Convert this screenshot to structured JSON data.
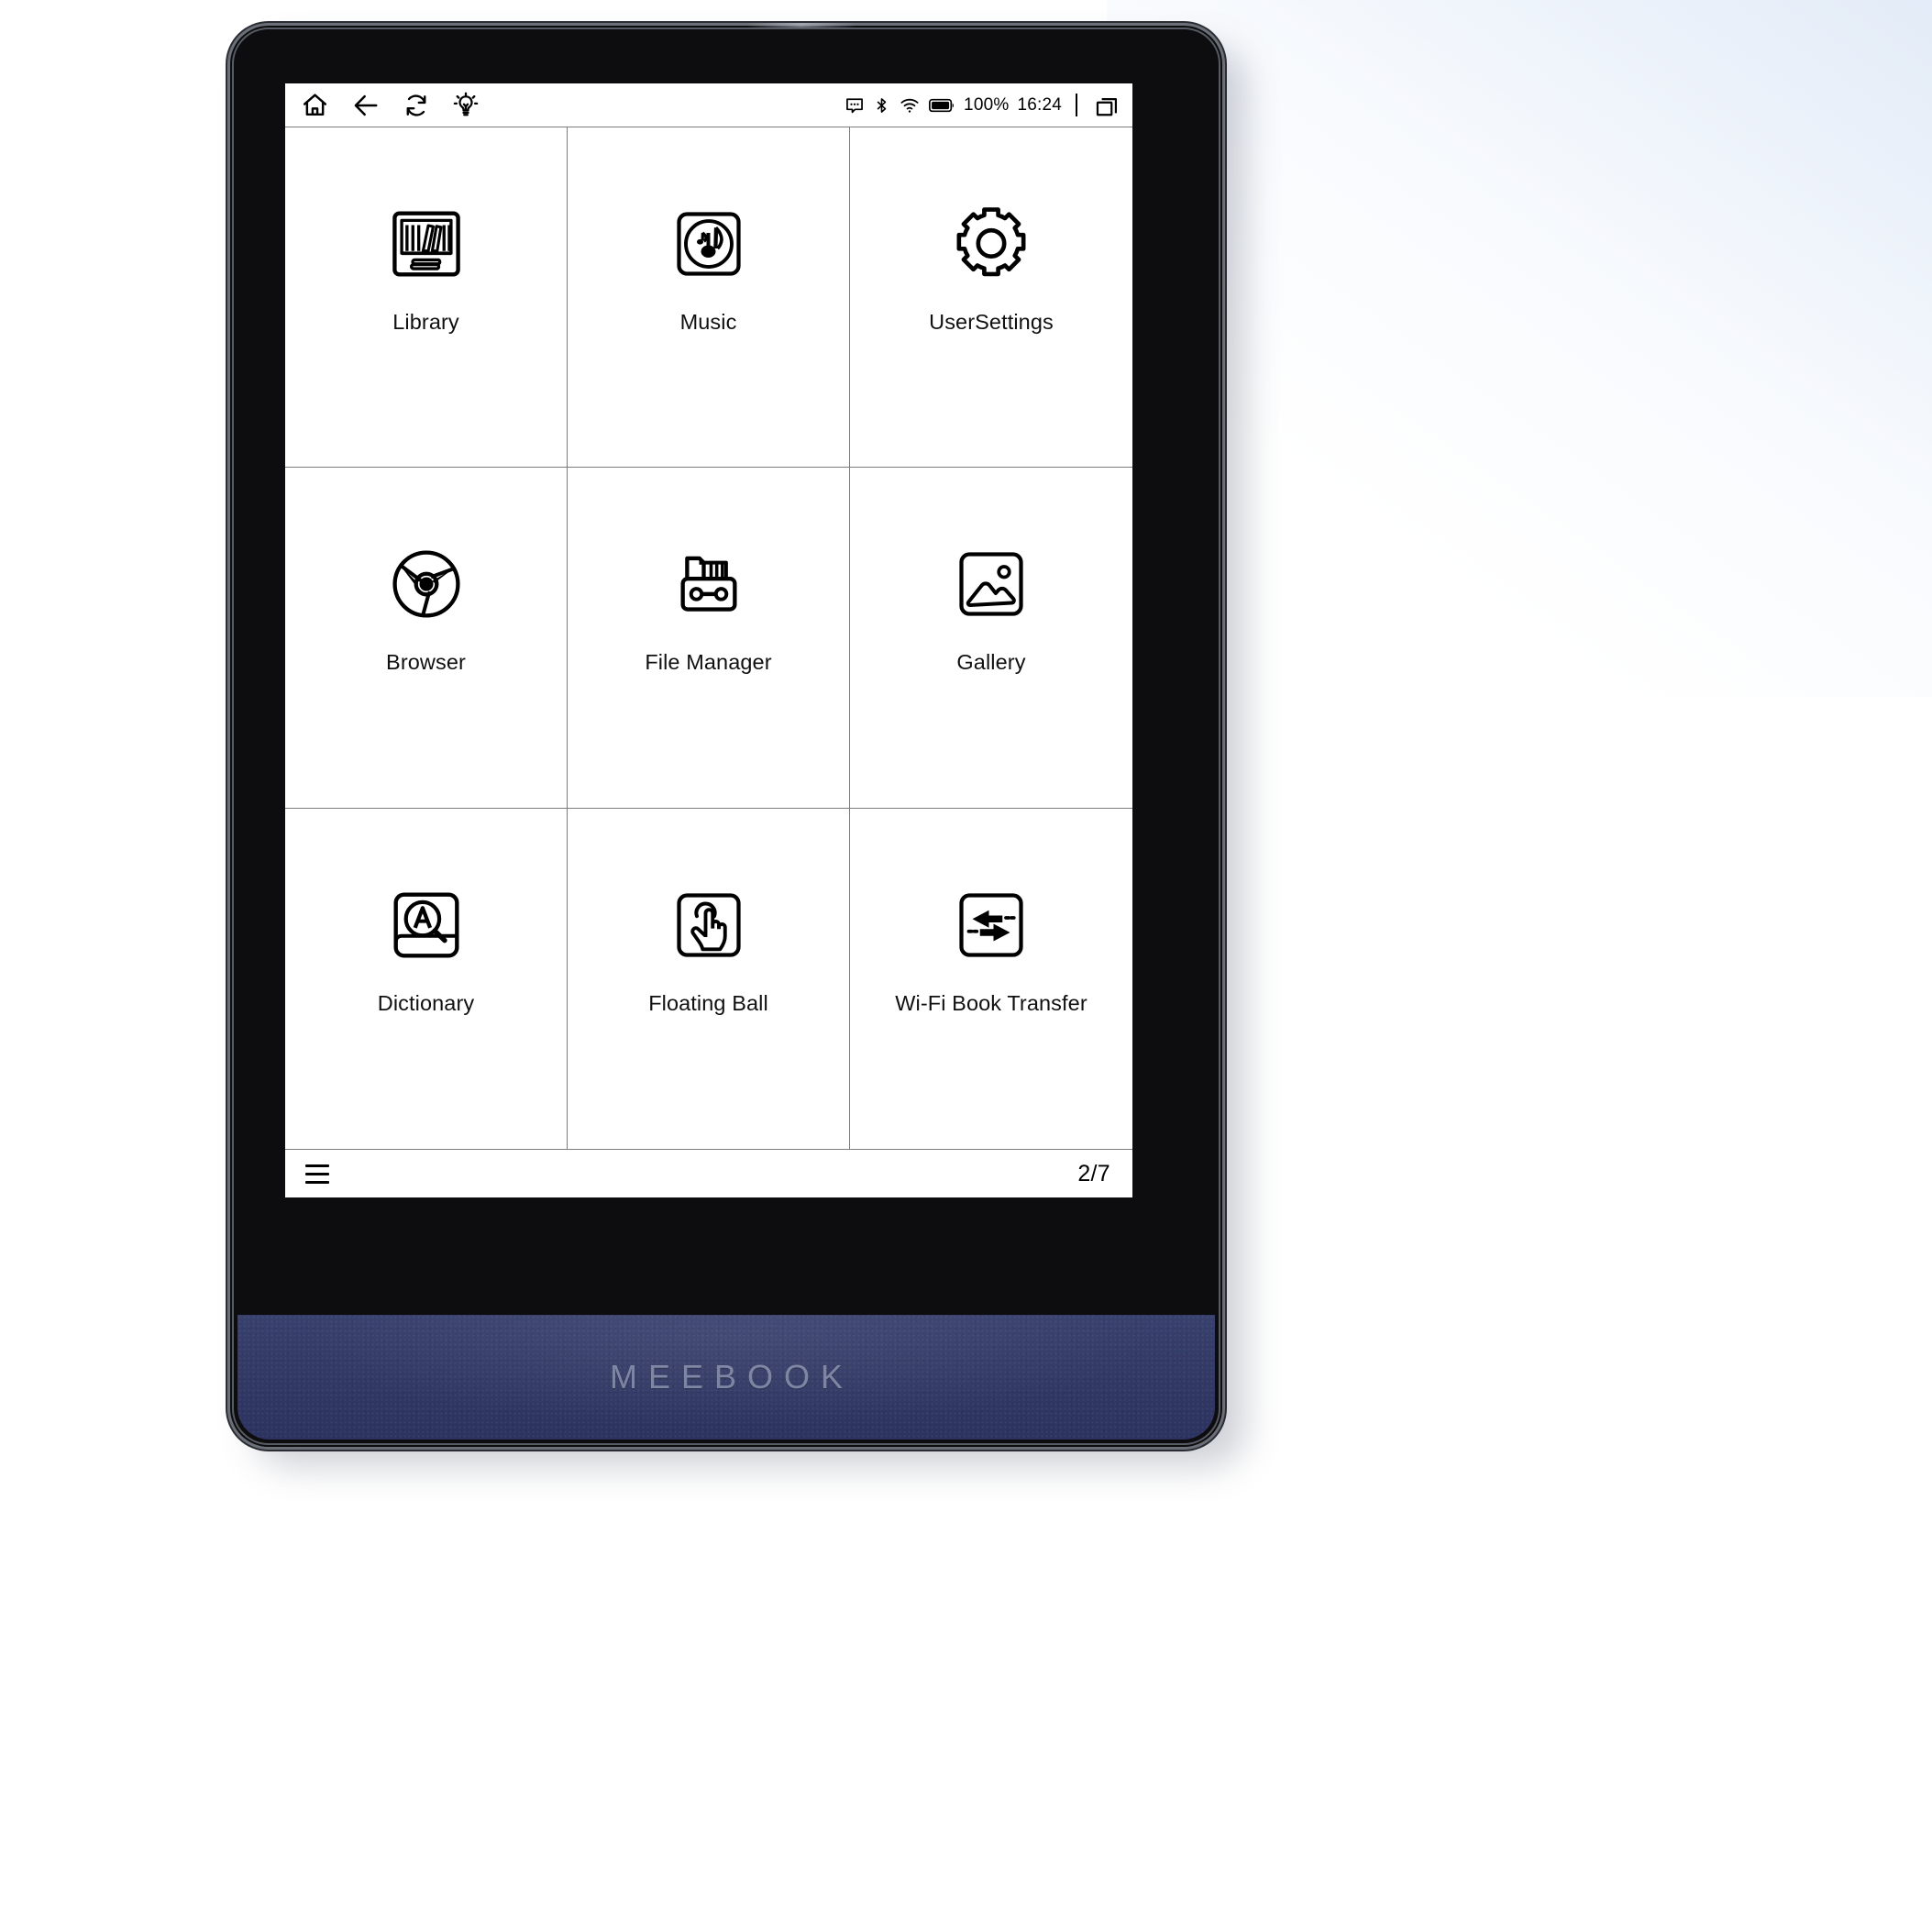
{
  "device": {
    "brand": "MEEBOOK",
    "frame_color": "#0d0d10",
    "chin_color": "#333a66",
    "bezel_rim_color": "#6b6f77"
  },
  "statusbar": {
    "left_icons": [
      {
        "name": "home-icon",
        "label": "Home"
      },
      {
        "name": "back-arrow-icon",
        "label": "Back"
      },
      {
        "name": "refresh-icon",
        "label": "Refresh"
      },
      {
        "name": "lightbulb-icon",
        "label": "Front light"
      }
    ],
    "right_icons": [
      {
        "name": "message-bubble-icon",
        "label": "Notifications"
      },
      {
        "name": "bluetooth-icon",
        "label": "Bluetooth"
      },
      {
        "name": "wifi-icon",
        "label": "Wi-Fi"
      },
      {
        "name": "battery-icon",
        "label": "Battery"
      }
    ],
    "battery_percent": "100%",
    "clock": "16:24",
    "multiwindow_icon": "multi-window-icon"
  },
  "grid": {
    "apps": [
      {
        "label": "Library",
        "icon": "bookshelf-icon"
      },
      {
        "label": "Music",
        "icon": "music-note-icon"
      },
      {
        "label": "UserSettings",
        "icon": "gear-icon"
      },
      {
        "label": "Browser",
        "icon": "chrome-browser-icon"
      },
      {
        "label": "File Manager",
        "icon": "file-drawer-icon"
      },
      {
        "label": "Gallery",
        "icon": "image-mountain-icon"
      },
      {
        "label": "Dictionary",
        "icon": "magnifier-a-book-icon"
      },
      {
        "label": "Floating Ball",
        "icon": "hand-tap-icon"
      },
      {
        "label": "Wi-Fi Book Transfer",
        "icon": "two-way-arrows-icon"
      }
    ]
  },
  "bottombar": {
    "menu_icon": "hamburger-menu-icon",
    "page_indicator": "2/7"
  }
}
